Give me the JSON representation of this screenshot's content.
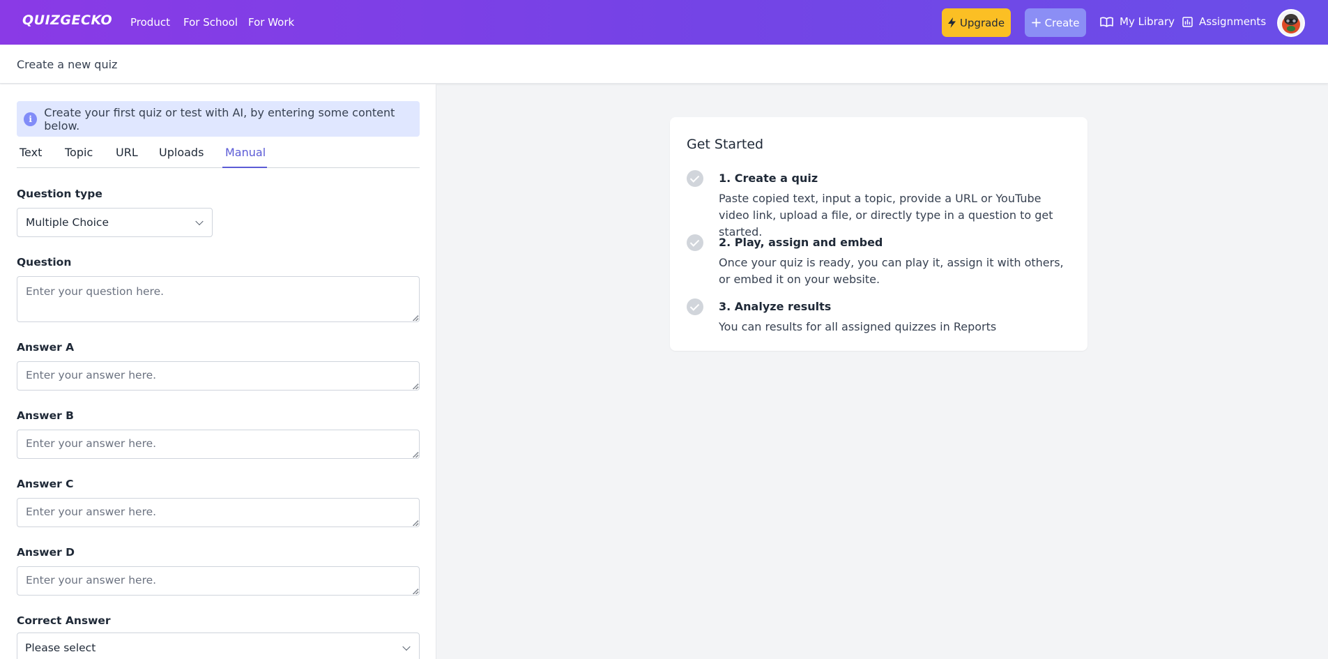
{
  "nav": {
    "logo": "QUIZGECKO",
    "links": [
      "Product",
      "For School",
      "For Work"
    ],
    "upgrade_label": "Upgrade",
    "create_label": "Create",
    "library_label": "My Library",
    "assignments_label": "Assignments",
    "accent_color": "#7543e6",
    "upgrade_color": "#fbbf24"
  },
  "subheader": {
    "title": "Create a new quiz"
  },
  "info_banner": {
    "text": "Create your first quiz or test with AI, by entering some content below."
  },
  "tabs": [
    {
      "label": "Text"
    },
    {
      "label": "Topic"
    },
    {
      "label": "URL"
    },
    {
      "label": "Uploads"
    },
    {
      "label": "Manual",
      "active": true
    }
  ],
  "form": {
    "question_type_label": "Question type",
    "question_type_value": "Multiple Choice",
    "question_label": "Question",
    "question_placeholder": "Enter your question here.",
    "answers": [
      {
        "label": "Answer A",
        "placeholder": "Enter your answer here."
      },
      {
        "label": "Answer B",
        "placeholder": "Enter your answer here."
      },
      {
        "label": "Answer C",
        "placeholder": "Enter your answer here."
      },
      {
        "label": "Answer D",
        "placeholder": "Enter your answer here."
      }
    ],
    "correct_label": "Correct Answer",
    "correct_value": "Please select"
  },
  "get_started": {
    "title": "Get Started",
    "steps": [
      {
        "title": "1. Create a quiz",
        "desc": "Paste copied text, input a topic, provide a URL or YouTube video link, upload a file, or directly type in a question to get started."
      },
      {
        "title": "2. Play, assign and embed",
        "desc": "Once your quiz is ready, you can play it, assign it with others, or embed it on your website."
      },
      {
        "title": "3. Analyze results",
        "desc": "You can results for all assigned quizzes in Reports"
      }
    ]
  }
}
